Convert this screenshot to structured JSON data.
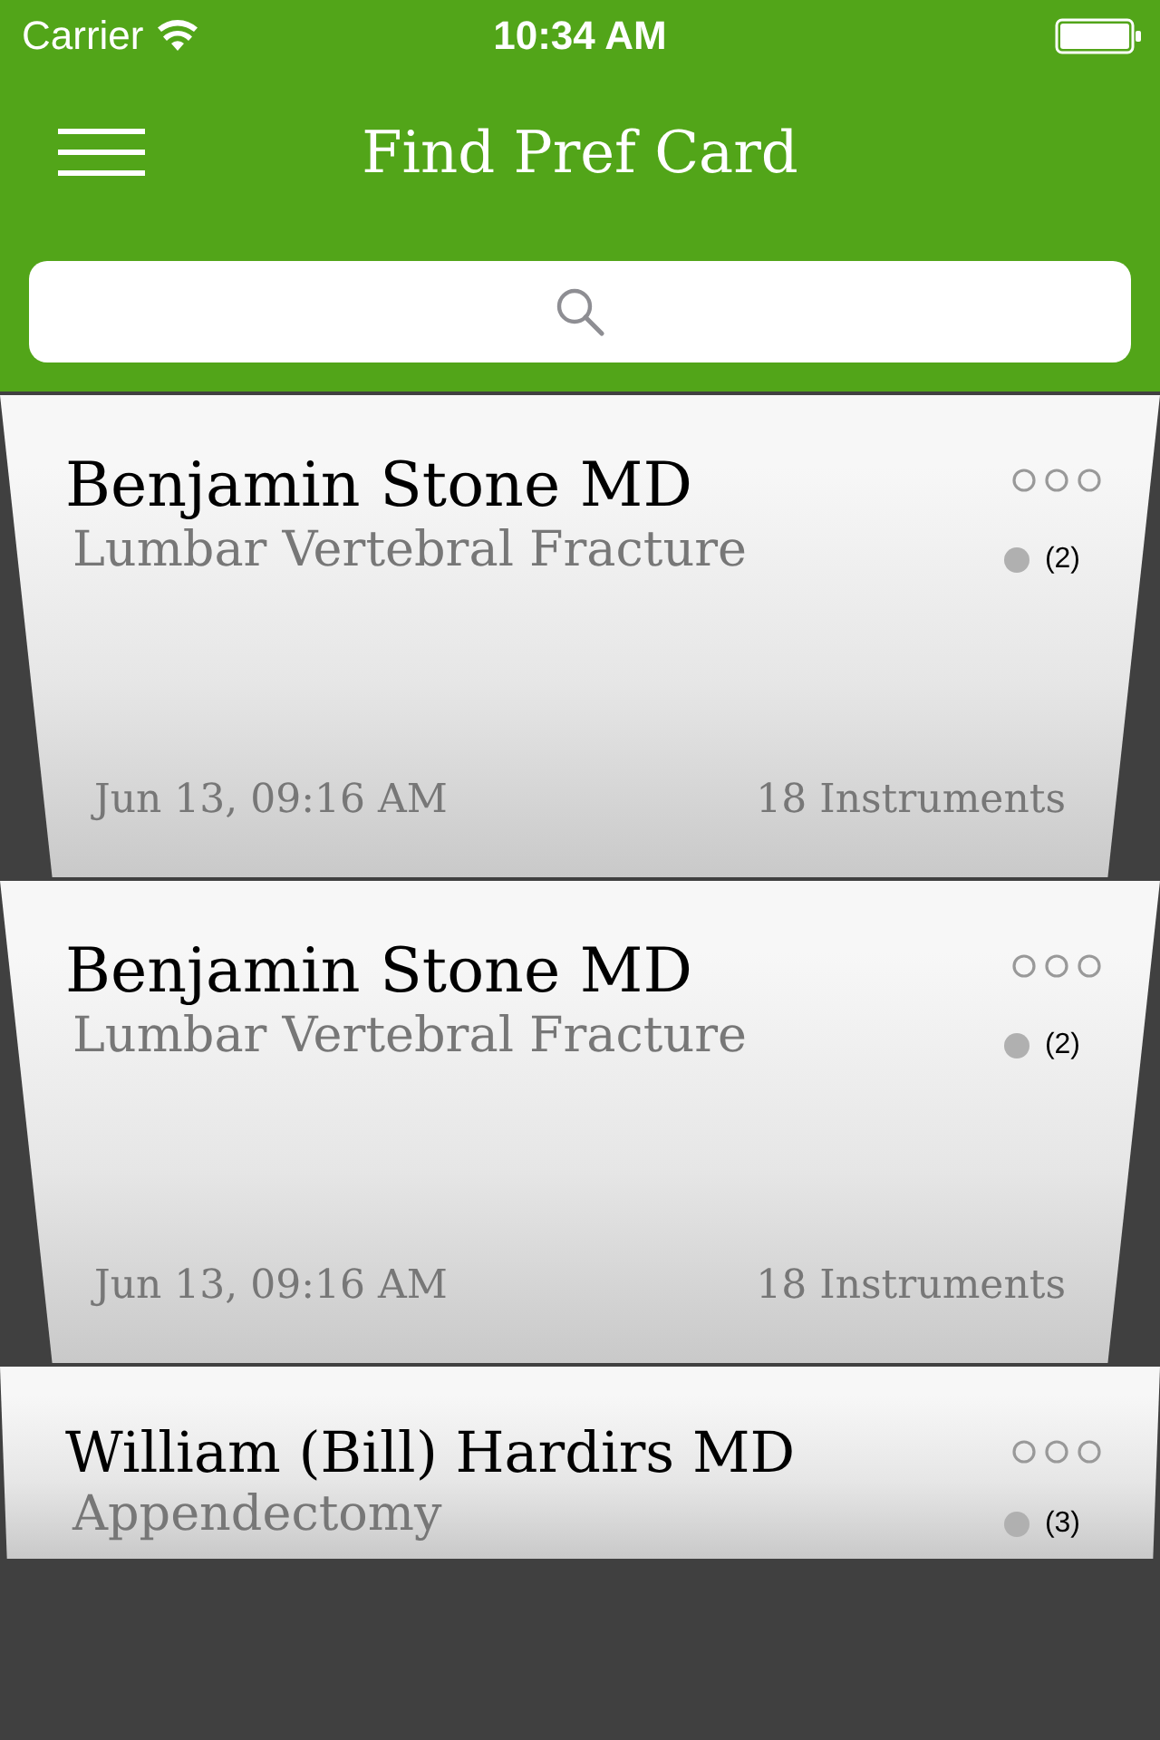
{
  "status_bar": {
    "carrier": "Carrier",
    "time": "10:34 AM"
  },
  "nav": {
    "title": "Find Pref Card"
  },
  "cards": [
    {
      "name": "Benjamin Stone MD",
      "procedure": "Lumbar Vertebral Fracture",
      "count": "(2)",
      "date": "Jun 13, 09:16 AM",
      "instruments": "18 Instruments"
    },
    {
      "name": "Benjamin Stone MD",
      "procedure": "Lumbar Vertebral Fracture",
      "count": "(2)",
      "date": "Jun 13, 09:16 AM",
      "instruments": "18 Instruments"
    },
    {
      "name": "William (Bill) Hardirs MD",
      "procedure": "Appendectomy",
      "count": "(3)"
    }
  ]
}
